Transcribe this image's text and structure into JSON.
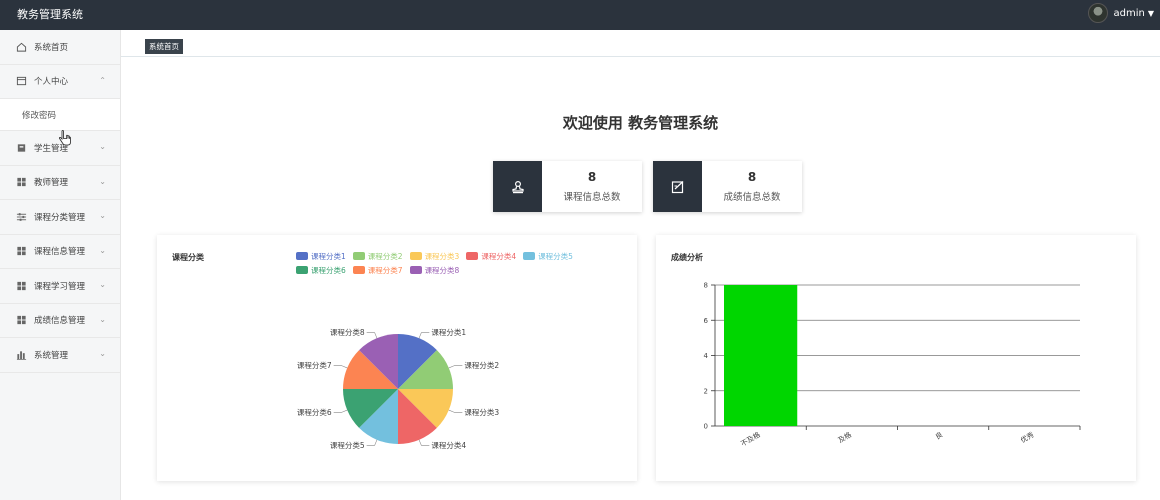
{
  "app": {
    "title": "教务管理系统"
  },
  "user": {
    "name": "admin"
  },
  "sidebar": {
    "items": [
      {
        "label": "系统首页",
        "icon": "home-icon",
        "arrow": ""
      },
      {
        "label": "个人中心",
        "icon": "profile-icon",
        "arrow": "⌃"
      },
      {
        "label": "学生管理",
        "icon": "student-icon",
        "arrow": "⌄"
      },
      {
        "label": "教师管理",
        "icon": "grid-icon",
        "arrow": "⌄"
      },
      {
        "label": "课程分类管理",
        "icon": "sliders-icon",
        "arrow": "⌄"
      },
      {
        "label": "课程信息管理",
        "icon": "grid-icon",
        "arrow": "⌄"
      },
      {
        "label": "课程学习管理",
        "icon": "grid-icon",
        "arrow": "⌄"
      },
      {
        "label": "成绩信息管理",
        "icon": "grid-icon",
        "arrow": "⌄"
      },
      {
        "label": "系统管理",
        "icon": "bar-chart-icon",
        "arrow": "⌄"
      }
    ],
    "submenu": {
      "label": "修改密码"
    }
  },
  "breadcrumb": {
    "label": "系统首页"
  },
  "welcome": {
    "text": "欢迎使用 教务管理系统"
  },
  "stats": [
    {
      "value": "8",
      "label": "课程信息总数",
      "icon": "stamp-icon"
    },
    {
      "value": "8",
      "label": "成绩信息总数",
      "icon": "edit-icon"
    }
  ],
  "colors": {
    "topbar": "#2b333d",
    "bar": "#00d600",
    "pie": [
      "#5470c6",
      "#91cc75",
      "#fac858",
      "#ee6666",
      "#73c0de",
      "#3ba272",
      "#fc8452",
      "#9a60b4"
    ]
  },
  "chart_data": [
    {
      "type": "pie",
      "title": "课程分类",
      "categories": [
        "课程分类1",
        "课程分类2",
        "课程分类3",
        "课程分类4",
        "课程分类5",
        "课程分类6",
        "课程分类7",
        "课程分类8"
      ],
      "values": [
        1,
        1,
        1,
        1,
        1,
        1,
        1,
        1
      ],
      "legend": "top"
    },
    {
      "type": "bar",
      "title": "成绩分析",
      "categories": [
        "不及格",
        "及格",
        "良",
        "优秀"
      ],
      "values": [
        8,
        0,
        0,
        0
      ],
      "ylim": [
        0,
        8
      ],
      "yticks": [
        0,
        2,
        4,
        6,
        8
      ],
      "grid": true
    }
  ]
}
